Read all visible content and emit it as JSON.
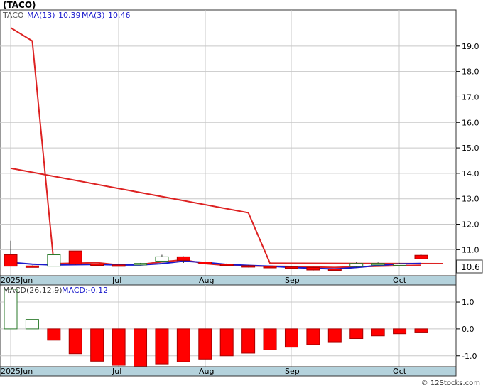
{
  "title": "(TACO)",
  "legend": {
    "symbol": "TACO",
    "ma13_label": "MA(13)",
    "ma13_value": "10.39",
    "ma3_label": "MA(3)",
    "ma3_value": "10.46"
  },
  "price_badge": "10.6",
  "macd_legend": {
    "label": "MACD(26,12,9)",
    "value_label": "MACD:-0.12"
  },
  "watermark": "© 12Stocks.com",
  "colors": {
    "up": "#ffffff",
    "down": "#ff0000",
    "ma13": "#dd2222",
    "ma3": "#1a1acc",
    "axis_band": "#b4d2dc",
    "grid": "#c8c8c8"
  },
  "chart_data": [
    {
      "type": "candlestick",
      "x_labels": [
        "2025Jun",
        "Jul",
        "Aug",
        "Sep",
        "Oct"
      ],
      "ylim": [
        10.2,
        20.0
      ],
      "y_ticks": [
        "19.0",
        "18.0",
        "17.0",
        "16.0",
        "15.0",
        "14.0",
        "13.0",
        "12.0",
        "11.0"
      ],
      "candles": [
        {
          "o": 10.8,
          "h": 11.35,
          "l": 10.35,
          "c": 10.35,
          "up": false
        },
        {
          "o": 10.36,
          "h": 10.38,
          "l": 10.3,
          "c": 10.32,
          "up": false
        },
        {
          "o": 10.35,
          "h": 10.82,
          "l": 10.35,
          "c": 10.8,
          "up": true
        },
        {
          "o": 10.95,
          "h": 10.95,
          "l": 10.4,
          "c": 10.43,
          "up": false
        },
        {
          "o": 10.44,
          "h": 10.46,
          "l": 10.36,
          "c": 10.38,
          "up": false
        },
        {
          "o": 10.4,
          "h": 10.42,
          "l": 10.38,
          "c": 10.4,
          "up": false
        },
        {
          "o": 10.4,
          "h": 10.48,
          "l": 10.38,
          "c": 10.46,
          "up": true
        },
        {
          "o": 10.55,
          "h": 10.8,
          "l": 10.5,
          "c": 10.72,
          "up": true
        },
        {
          "o": 10.72,
          "h": 10.74,
          "l": 10.48,
          "c": 10.58,
          "up": false
        },
        {
          "o": 10.52,
          "h": 10.54,
          "l": 10.42,
          "c": 10.44,
          "up": false
        },
        {
          "o": 10.43,
          "h": 10.46,
          "l": 10.36,
          "c": 10.38,
          "up": false
        },
        {
          "o": 10.37,
          "h": 10.4,
          "l": 10.3,
          "c": 10.32,
          "up": false
        },
        {
          "o": 10.34,
          "h": 10.37,
          "l": 10.3,
          "c": 10.32,
          "up": false
        },
        {
          "o": 10.32,
          "h": 10.34,
          "l": 10.25,
          "c": 10.28,
          "up": false
        },
        {
          "o": 10.3,
          "h": 10.32,
          "l": 10.18,
          "c": 10.2,
          "up": false
        },
        {
          "o": 10.24,
          "h": 10.26,
          "l": 10.18,
          "c": 10.22,
          "up": false
        },
        {
          "o": 10.34,
          "h": 10.52,
          "l": 10.3,
          "c": 10.46,
          "up": true
        },
        {
          "o": 10.4,
          "h": 10.5,
          "l": 10.38,
          "c": 10.46,
          "up": true
        },
        {
          "o": 10.42,
          "h": 10.48,
          "l": 10.4,
          "c": 10.44,
          "up": true
        },
        {
          "o": 10.78,
          "h": 10.8,
          "l": 10.62,
          "c": 10.64,
          "up": false
        }
      ],
      "ma13": [
        19.72,
        19.2,
        10.45,
        10.47,
        10.49,
        10.4,
        10.42,
        10.52,
        10.6,
        10.45,
        10.38,
        10.36,
        10.35,
        10.34,
        10.32,
        10.3,
        10.33,
        10.35,
        10.37,
        10.39
      ],
      "ma3": [
        10.5,
        10.43,
        10.4,
        10.41,
        10.42,
        10.4,
        10.4,
        10.45,
        10.55,
        10.5,
        10.42,
        10.38,
        10.35,
        10.3,
        10.27,
        10.24,
        10.3,
        10.38,
        10.44,
        10.46
      ],
      "ma13_trend": [
        [
          0,
          14.2
        ],
        [
          11,
          12.45
        ],
        [
          12,
          10.47
        ],
        [
          20,
          10.45
        ]
      ]
    },
    {
      "type": "bar",
      "series": [
        {
          "name": "MACD(26,12,9)",
          "values": [
            1.48,
            0.35,
            -0.42,
            -0.92,
            -1.2,
            -1.35,
            -1.4,
            -1.3,
            -1.22,
            -1.12,
            -1.0,
            -0.9,
            -0.78,
            -0.68,
            -0.58,
            -0.48,
            -0.36,
            -0.26,
            -0.18,
            -0.12
          ]
        }
      ],
      "ylim": [
        -1.35,
        1.45
      ],
      "y_ticks": [
        "1.0",
        "0.0",
        "-1.0"
      ]
    }
  ]
}
